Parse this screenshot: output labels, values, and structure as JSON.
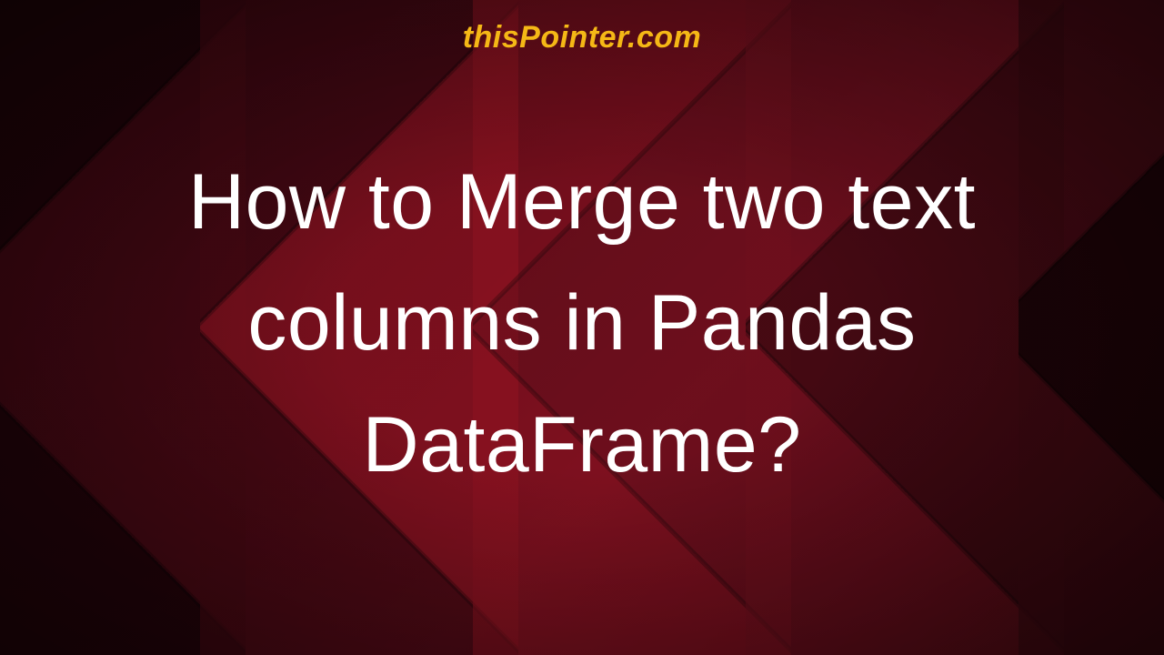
{
  "brand": "thisPointer.com",
  "title": "How to Merge two text columns in Pandas DataFrame?"
}
